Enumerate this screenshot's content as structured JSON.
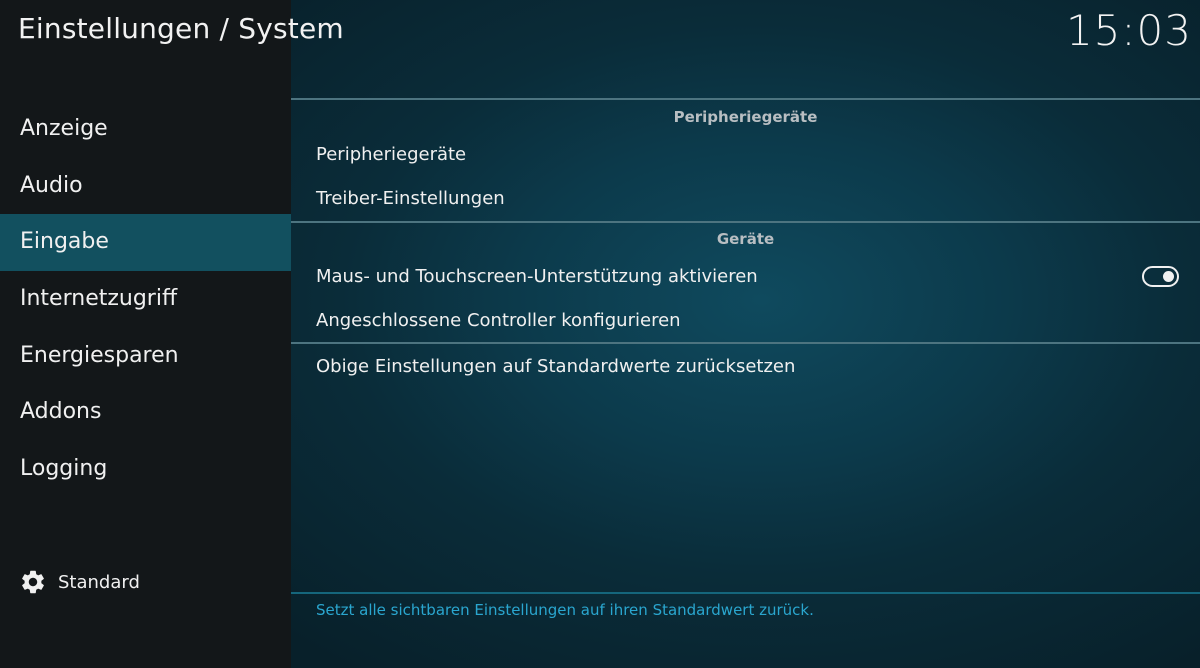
{
  "header": {
    "title": "Einstellungen / System",
    "clock": "15:03"
  },
  "sidebar": {
    "items": [
      {
        "label": "Anzeige"
      },
      {
        "label": "Audio"
      },
      {
        "label": "Eingabe"
      },
      {
        "label": "Internetzugriff"
      },
      {
        "label": "Energiesparen"
      },
      {
        "label": "Addons"
      },
      {
        "label": "Logging"
      }
    ],
    "active_index": 2,
    "footer": {
      "icon": "gear-icon",
      "label": "Standard"
    }
  },
  "main": {
    "sections": [
      {
        "title": "Peripheriegeräte",
        "items": [
          {
            "label": "Peripheriegeräte"
          },
          {
            "label": "Treiber-Einstellungen"
          }
        ]
      },
      {
        "title": "Geräte",
        "items": [
          {
            "label": "Maus- und Touchscreen-Unterstützung aktivieren",
            "toggle": true
          },
          {
            "label": "Angeschlossene Controller konfigurieren"
          }
        ]
      }
    ],
    "reset_label": "Obige Einstellungen auf Standardwerte zurücksetzen",
    "description": "Setzt alle sichtbaren Einstellungen auf ihren Standardwert zurück."
  },
  "colors": {
    "active_item_bg": "#12505f",
    "description_text": "#2aa6cf",
    "separator": "#4d7480"
  }
}
